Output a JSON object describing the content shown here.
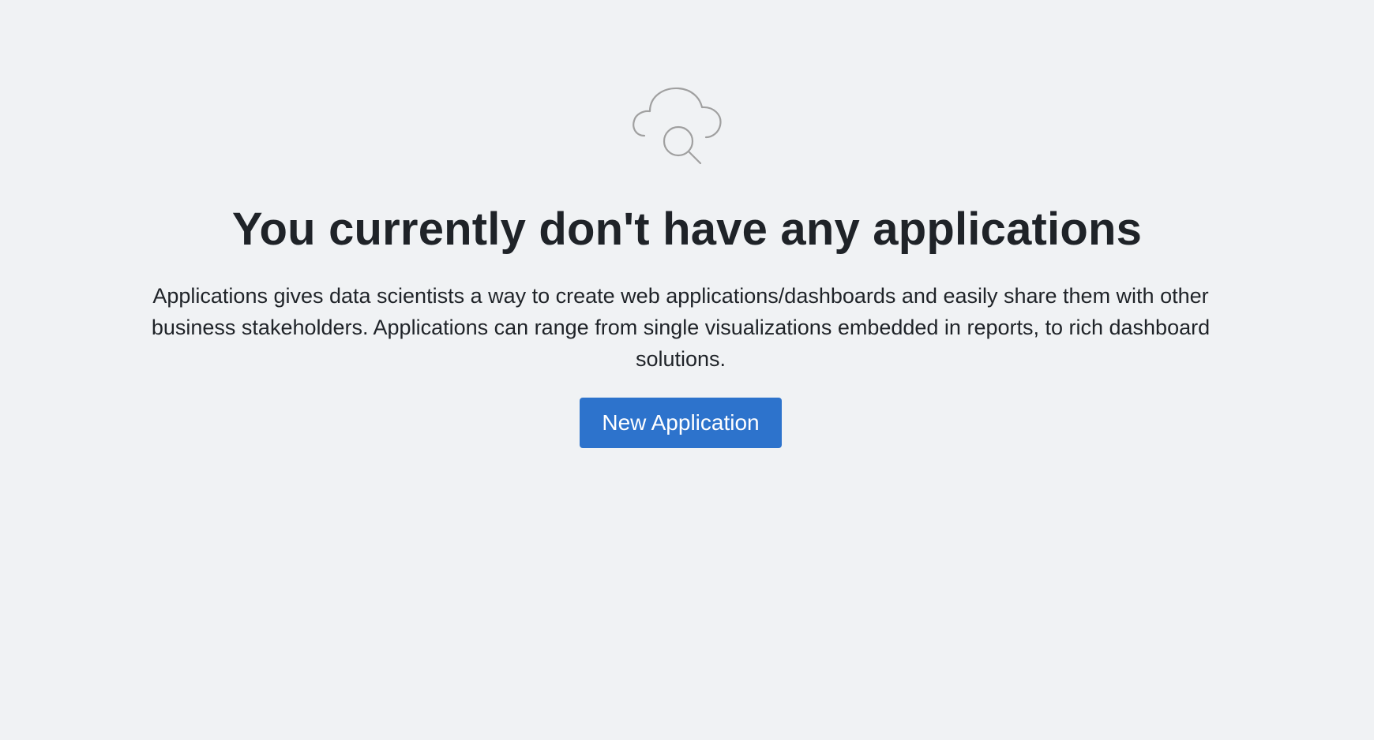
{
  "empty_state": {
    "icon": "cloud-search-icon",
    "title": "You currently don't have any applications",
    "description": "Applications gives data scientists a way to create web applications/dashboards and easily share them with other business stakeholders. Applications can range from single visualizations embedded in reports, to rich dashboard solutions.",
    "button_label": "New Application"
  },
  "colors": {
    "background": "#f0f2f4",
    "text": "#1f2328",
    "accent": "#2d73cc",
    "icon": "#a0a0a0"
  }
}
